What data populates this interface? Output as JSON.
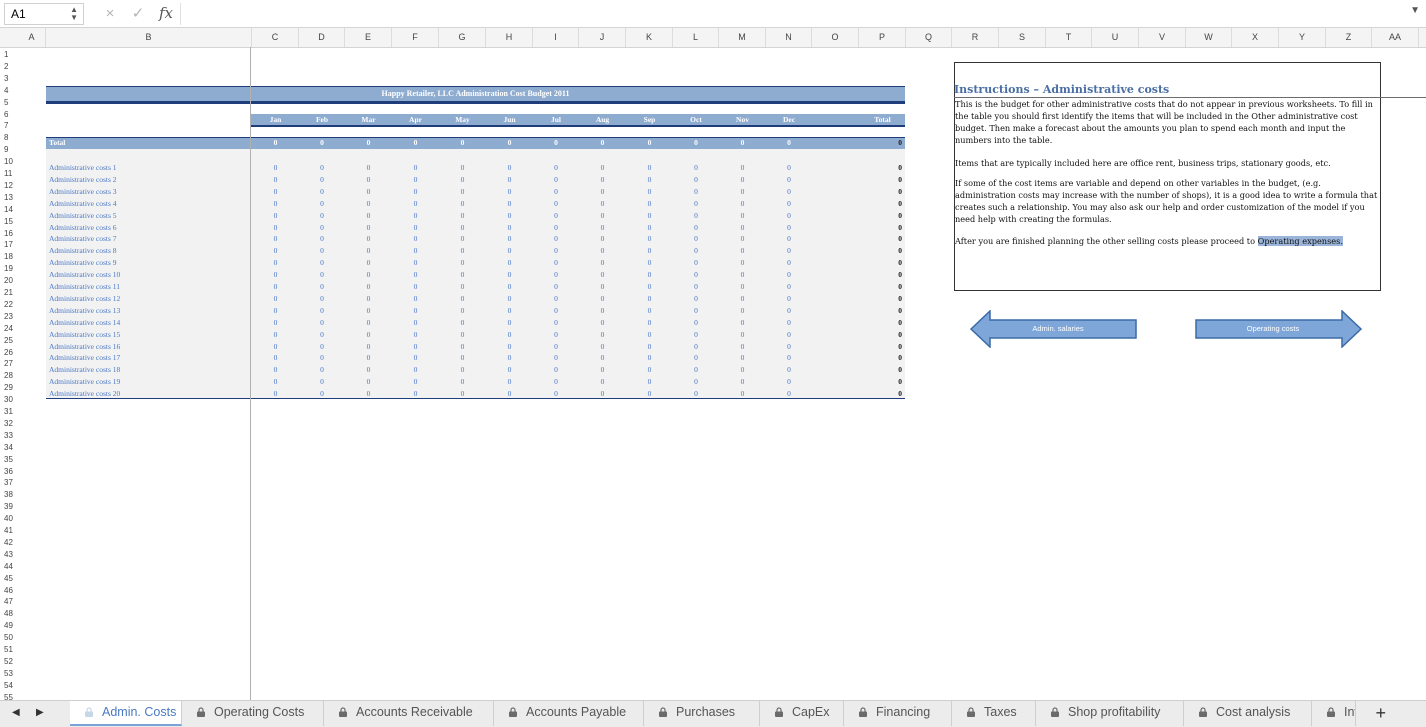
{
  "formula_bar": {
    "cell_ref": "A1",
    "cancel_icon": "×",
    "enter_icon": "✓",
    "fx_label": "fx"
  },
  "columns": [
    "A",
    "B",
    "C",
    "D",
    "E",
    "F",
    "G",
    "H",
    "I",
    "J",
    "K",
    "L",
    "M",
    "N",
    "O",
    "P",
    "Q",
    "R",
    "S",
    "T",
    "U",
    "V",
    "W",
    "X",
    "Y",
    "Z",
    "AA"
  ],
  "rows": [
    "1",
    "2",
    "3",
    "4",
    "5",
    "6",
    "7",
    "8",
    "9",
    "10",
    "11",
    "12",
    "13",
    "14",
    "15",
    "16",
    "17",
    "18",
    "19",
    "20",
    "21",
    "22",
    "23",
    "24",
    "25",
    "26",
    "27",
    "28",
    "29",
    "30",
    "31",
    "32",
    "33",
    "34",
    "35",
    "36",
    "37",
    "38",
    "39",
    "40",
    "41",
    "42",
    "43",
    "44",
    "45",
    "46",
    "47",
    "48",
    "49",
    "50",
    "51",
    "52",
    "53",
    "54",
    "55"
  ],
  "budget": {
    "title": "Happy Retailer, LLC Administration Cost Budget 2011",
    "months": [
      "Jan",
      "Feb",
      "Mar",
      "Apr",
      "May",
      "Jun",
      "Jul",
      "Aug",
      "Sep",
      "Oct",
      "Nov",
      "Dec"
    ],
    "total_header": "Total",
    "total_label": "Total",
    "total_values": [
      "0",
      "0",
      "0",
      "0",
      "0",
      "0",
      "0",
      "0",
      "0",
      "0",
      "0",
      "0"
    ],
    "total_sum": "0",
    "items": [
      "Administrative costs 1",
      "Administrative costs 2",
      "Administrative costs 3",
      "Administrative costs 4",
      "Administrative costs 5",
      "Administrative costs 6",
      "Administrative costs 7",
      "Administrative costs 8",
      "Administrative costs 9",
      "Administrative costs 10",
      "Administrative costs 11",
      "Administrative costs 12",
      "Administrative costs 13",
      "Administrative costs 14",
      "Administrative costs 15",
      "Administrative costs 16",
      "Administrative costs 17",
      "Administrative costs 18",
      "Administrative costs 19",
      "Administrative costs 20"
    ],
    "cell_value": "0"
  },
  "instructions": {
    "title": "Instructions – Administrative costs",
    "p1": "This is the budget for other administrative costs that do not appear in previous worksheets. To fill in the table you should first identify the items that will be included in the Other administrative cost budget. Then make a forecast about the amounts you plan to spend each month and input the numbers into the table.",
    "p2": "Items that are typically included here are office rent, business trips, stationary goods, etc.",
    "p3": "If some of the cost items are variable and depend on other variables in the budget, (e.g. administration costs may increase with the number of shops), it is a good idea to write a formula that creates such a relationship. You may also ask our help and order customization of the model if you need help with creating the formulas.",
    "p4_prefix": "After you are finished planning the other selling costs please proceed to ",
    "p4_link": "Operating expenses."
  },
  "nav_buttons": {
    "prev_label": "Admin. salaries",
    "next_label": "Operating costs",
    "fill_color": "#7ea6d8",
    "stroke_color": "#3b6aa6"
  },
  "tabs": [
    {
      "label": "Admin. Costs",
      "active": true
    },
    {
      "label": "Operating Costs",
      "active": false
    },
    {
      "label": "Accounts Receivable",
      "active": false
    },
    {
      "label": "Accounts Payable",
      "active": false
    },
    {
      "label": "Purchases",
      "active": false
    },
    {
      "label": "CapEx",
      "active": false
    },
    {
      "label": "Financing",
      "active": false
    },
    {
      "label": "Taxes",
      "active": false
    },
    {
      "label": "Shop profitability",
      "active": false
    },
    {
      "label": "Cost analysis",
      "active": false
    },
    {
      "label": "Inv",
      "active": false
    }
  ],
  "tab_add": "+",
  "tab_prev": "◀",
  "tab_next": "▶"
}
